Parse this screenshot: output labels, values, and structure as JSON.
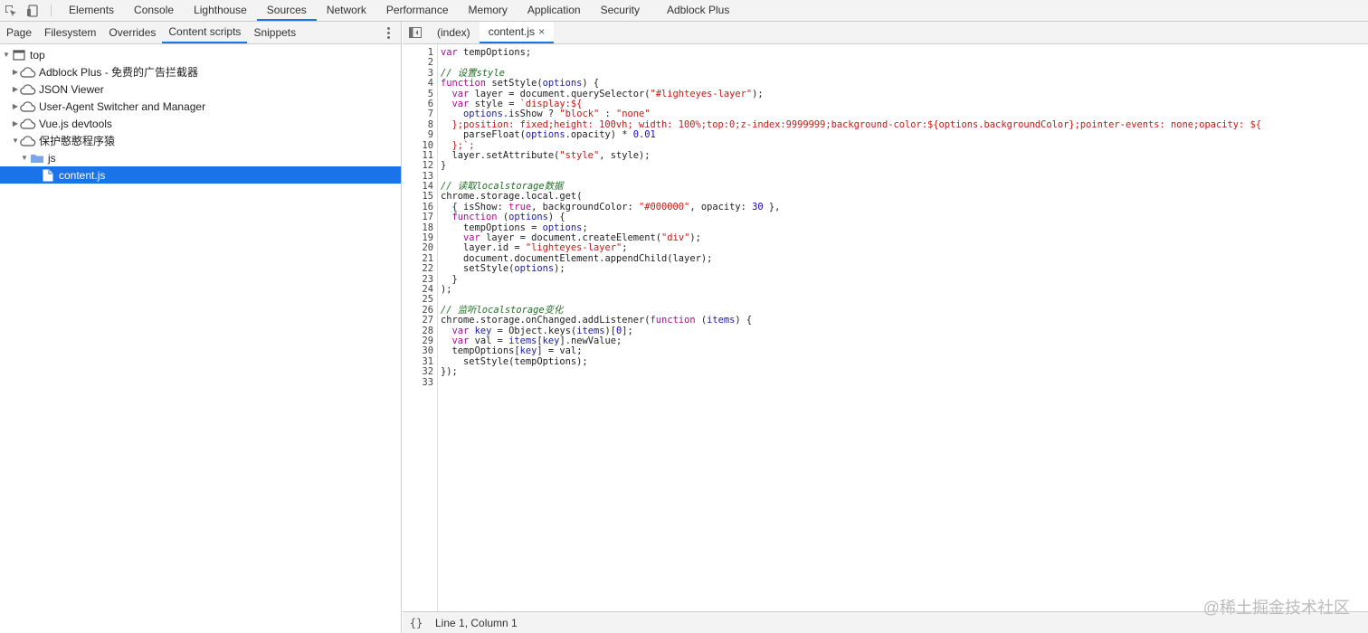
{
  "toolbar": {
    "tabs": [
      "Elements",
      "Console",
      "Lighthouse",
      "Sources",
      "Network",
      "Performance",
      "Memory",
      "Application",
      "Security",
      "Adblock Plus"
    ],
    "active_tab": "Sources"
  },
  "navigator": {
    "tabs": [
      "Page",
      "Filesystem",
      "Overrides",
      "Content scripts",
      "Snippets"
    ],
    "active_tab": "Content scripts",
    "tree": [
      {
        "label": "top",
        "icon": "frame-icon"
      },
      {
        "label": "Adblock Plus - 免费的广告拦截器",
        "icon": "cloud-icon"
      },
      {
        "label": "JSON Viewer",
        "icon": "cloud-icon"
      },
      {
        "label": "User-Agent Switcher and Manager",
        "icon": "cloud-icon"
      },
      {
        "label": "Vue.js devtools",
        "icon": "cloud-icon"
      },
      {
        "label": "保护憨憨程序猿",
        "icon": "cloud-icon"
      },
      {
        "label": "js",
        "icon": "folder-icon"
      },
      {
        "label": "content.js",
        "icon": "file-icon"
      }
    ]
  },
  "editor": {
    "tabs": [
      {
        "label": "(index)"
      },
      {
        "label": "content.js",
        "close": "×"
      }
    ],
    "lines": [
      "var tempOptions;",
      "",
      "// 设置style",
      "function setStyle(options) {",
      "  var layer = document.querySelector(\"#lighteyes-layer\");",
      "  var style = `display:${",
      "    options.isShow ? \"block\" : \"none\"",
      "  };position: fixed;height: 100vh; width: 100%;top:0;z-index:9999999;background-color:${options.backgroundColor};pointer-events: none;opacity: ${",
      "    parseFloat(options.opacity) * 0.01",
      "  };`;",
      "  layer.setAttribute(\"style\", style);",
      "}",
      "",
      "// 读取localstorage数据",
      "chrome.storage.local.get(",
      "  { isShow: true, backgroundColor: \"#000000\", opacity: 30 },",
      "  function (options) {",
      "    tempOptions = options;",
      "    var layer = document.createElement(\"div\");",
      "    layer.id = \"lighteyes-layer\";",
      "    document.documentElement.appendChild(layer);",
      "    setStyle(options);",
      "  }",
      ");",
      "",
      "// 监听localstorage变化",
      "chrome.storage.onChanged.addListener(function (items) {",
      "  var key = Object.keys(items)[0];",
      "  var val = items[key].newValue;",
      "  tempOptions[key] = val;",
      "    setStyle(tempOptions);",
      "});",
      ""
    ]
  },
  "status": {
    "pretty_print": "{}",
    "position": "Line 1, Column 1"
  },
  "watermark": "@稀土掘金技术社区",
  "colors": {
    "accent": "#1a73e8",
    "keyword": "#aa0d91",
    "string": "#c41a16",
    "comment": "#236e25",
    "number": "#1c00cf",
    "variable": "#1a1aa6"
  }
}
